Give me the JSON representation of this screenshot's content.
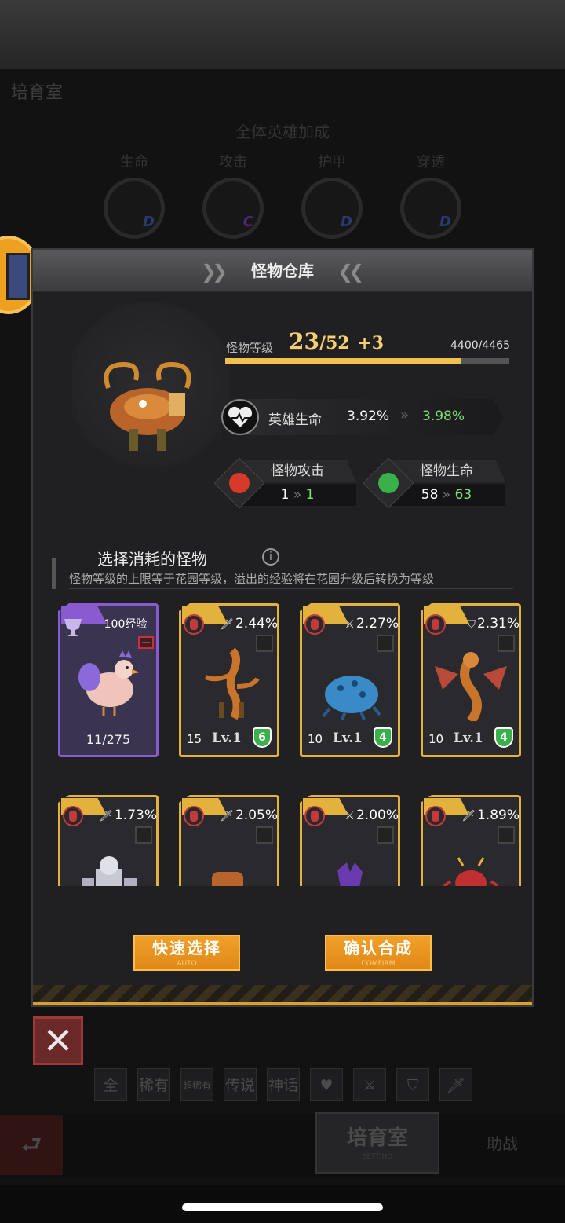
{
  "background": {
    "title": "培育室",
    "bonus_title": "全体英雄加成",
    "stats": [
      {
        "label": "生命",
        "grade": "D",
        "grade_color": "#3a5ad0"
      },
      {
        "label": "攻击",
        "grade": "C",
        "grade_color": "#8a3ad0"
      },
      {
        "label": "护甲",
        "grade": "D",
        "grade_color": "#3a5ad0"
      },
      {
        "label": "穿透",
        "grade": "D",
        "grade_color": "#3a5ad0"
      }
    ]
  },
  "panel": {
    "title": "怪物仓库",
    "level_label": "怪物等级",
    "level": "23",
    "level_max": "/52",
    "level_bonus": "+3",
    "exp": "4400/4465",
    "exp_fraction": 0.83,
    "hero": {
      "label": "英雄生命",
      "from": "3.92%",
      "arrow": "»",
      "to": "3.98%"
    },
    "attack": {
      "label": "怪物攻击",
      "from": "1",
      "to": "1",
      "icon": "red-shield-icon",
      "color": "#d83a2a"
    },
    "health": {
      "label": "怪物生命",
      "from": "58",
      "to": "63",
      "icon": "green-shield-icon",
      "color": "#3ab04a"
    },
    "select_title": "选择消耗的怪物",
    "info": "i",
    "hint": "怪物等级的上限等于花园等级，溢出的经验将在花园升级后转换为等级"
  },
  "cards": [
    {
      "kind": "exp",
      "exp_label": "100经验",
      "count": "11/275"
    },
    {
      "pct": "2.44%",
      "stat_icon": "dagger-icon",
      "lvnum": "15",
      "lv": "Lv.1",
      "star": "6"
    },
    {
      "pct": "2.27%",
      "stat_icon": "sword-icon",
      "lvnum": "10",
      "lv": "Lv.1",
      "star": "4"
    },
    {
      "pct": "2.31%",
      "stat_icon": "shield-icon",
      "lvnum": "10",
      "lv": "Lv.1",
      "star": "4"
    },
    {
      "pct": "1.73%",
      "stat_icon": "dagger-icon"
    },
    {
      "pct": "2.05%",
      "stat_icon": "dagger-icon"
    },
    {
      "pct": "2.00%",
      "stat_icon": "sword-icon"
    },
    {
      "pct": "1.89%",
      "stat_icon": "dagger-icon"
    }
  ],
  "buttons": {
    "auto": {
      "label": "快速选择",
      "sub": "AUTO"
    },
    "confirm": {
      "label": "确认合成",
      "sub": "COMFIRM"
    }
  },
  "filters": [
    "全",
    "稀有",
    "超稀有",
    "传说",
    "神话"
  ],
  "nav": {
    "active": "培育室",
    "active_sub": "SETTING",
    "help": "助战"
  },
  "colors": {
    "accent": "#e2b23c",
    "positive": "#7fe070",
    "level": "#f6d070"
  }
}
